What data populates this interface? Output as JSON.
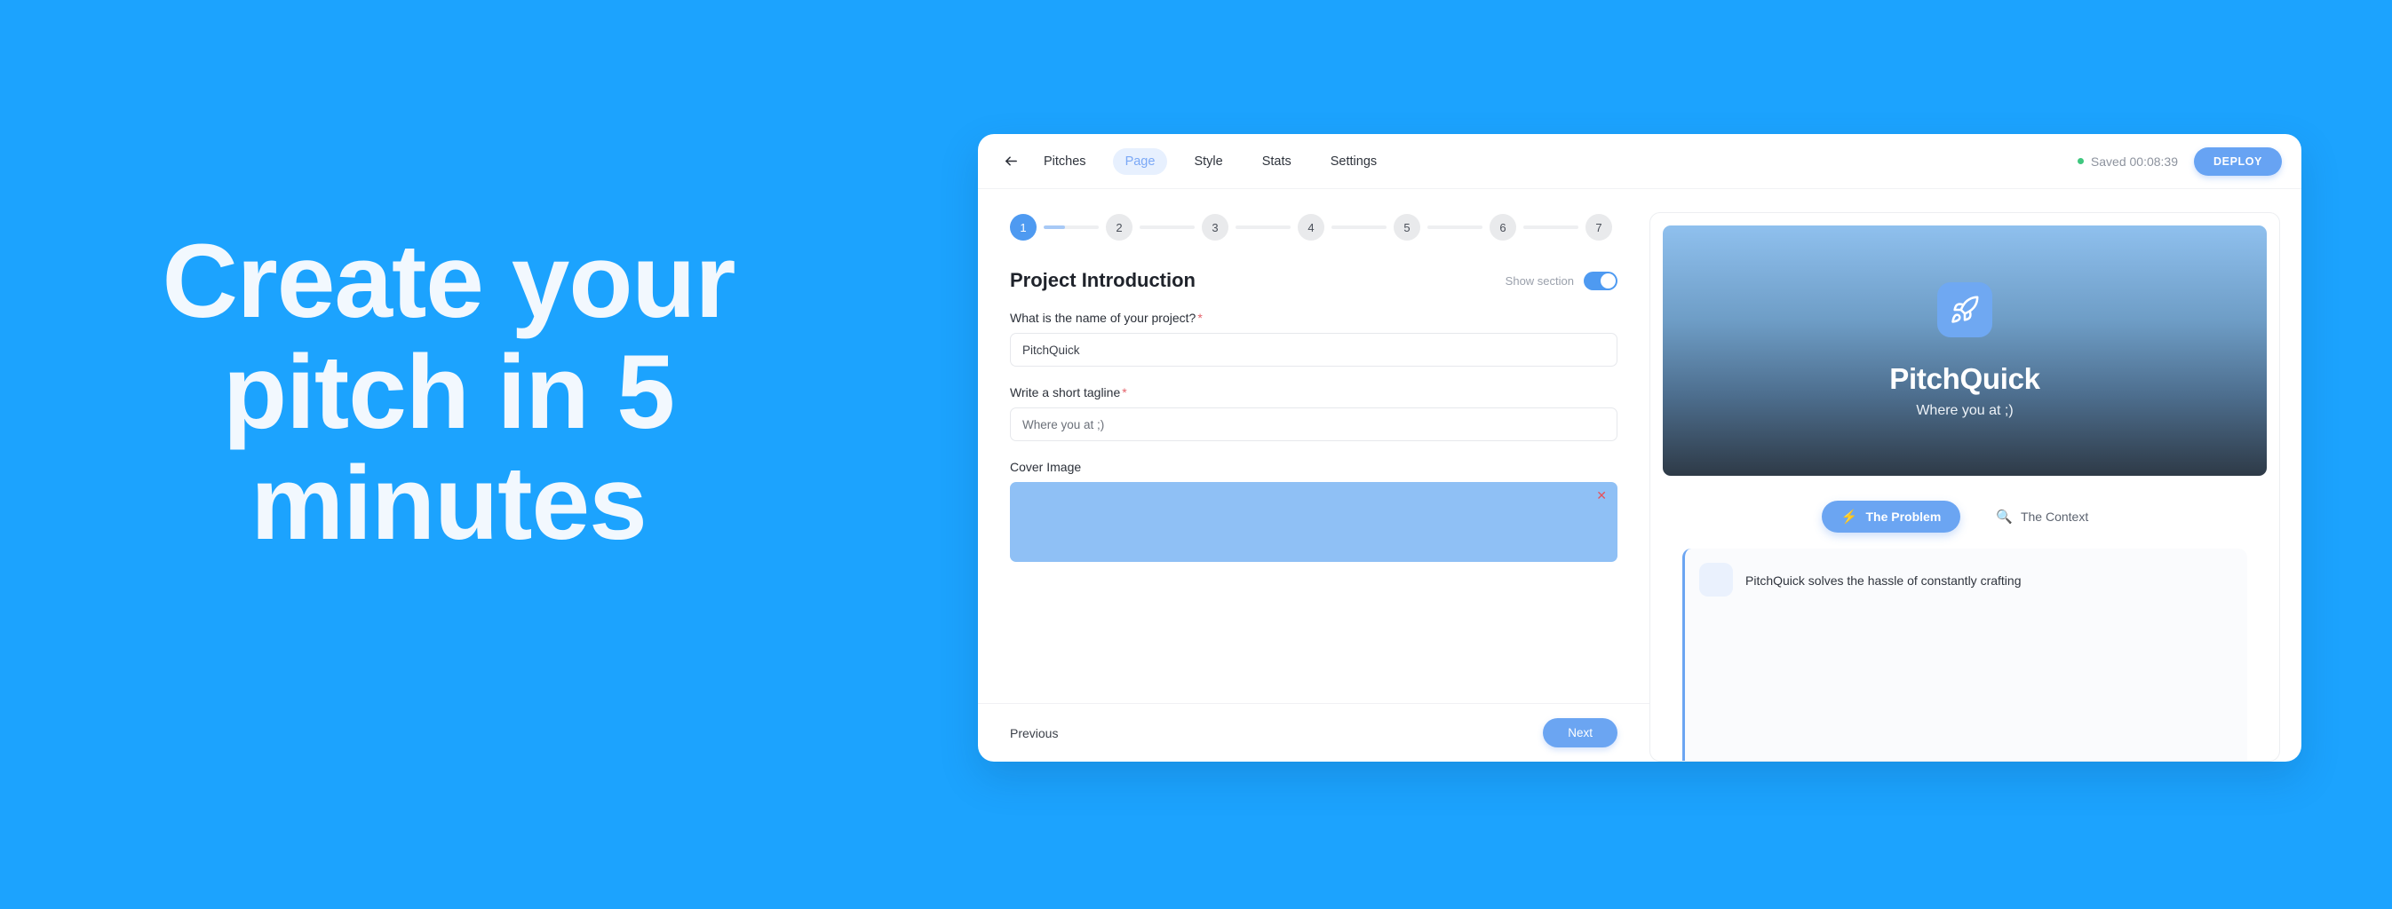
{
  "marketing": {
    "headline_lines": [
      "Create your",
      "pitch in 5",
      "minutes"
    ]
  },
  "colors": {
    "page_background": "#1CA3FE",
    "accent_blue": "#4E9AF1",
    "button_blue": "#6BA5F2",
    "saved_dot_green": "#3FC77F",
    "required_red": "#E4636B",
    "remove_red": "#E5535C"
  },
  "topbar": {
    "back_icon": "arrow-left-icon",
    "breadcrumb": "Pitches",
    "tabs": [
      {
        "label": "Page",
        "active": true
      },
      {
        "label": "Style",
        "active": false
      },
      {
        "label": "Stats",
        "active": false
      },
      {
        "label": "Settings",
        "active": false
      }
    ],
    "saved_status": "Saved 00:08:39",
    "deploy_label": "DEPLOY"
  },
  "stepper": {
    "steps": [
      "1",
      "2",
      "3",
      "4",
      "5",
      "6",
      "7"
    ],
    "current": 1,
    "first_connector_fill_percent": 38
  },
  "editor": {
    "section_title": "Project Introduction",
    "show_section_label": "Show section",
    "show_section_on": true,
    "fields": [
      {
        "label": "What is the name of your project?",
        "required": true,
        "value": "PitchQuick",
        "placeholder": "PitchQuick"
      },
      {
        "label": "Write a short tagline",
        "required": true,
        "value": "",
        "placeholder": "Where you at ;)"
      }
    ],
    "cover_image_label": "Cover Image",
    "cover_remove_icon": "close-x-icon",
    "cover_remove_glyph": "✕",
    "previous_label": "Previous",
    "next_label": "Next"
  },
  "preview": {
    "hero_icon": "rocket-icon",
    "title": "PitchQuick",
    "tagline": "Where you at ;)",
    "tabs": [
      {
        "icon": "lightning-bolt-icon",
        "glyph": "⚡",
        "label": "The Problem",
        "active": true
      },
      {
        "icon": "magnifying-glass-icon",
        "glyph": "🔍",
        "label": "The Context",
        "active": false
      }
    ],
    "body_text": "PitchQuick solves the hassle of constantly crafting"
  }
}
